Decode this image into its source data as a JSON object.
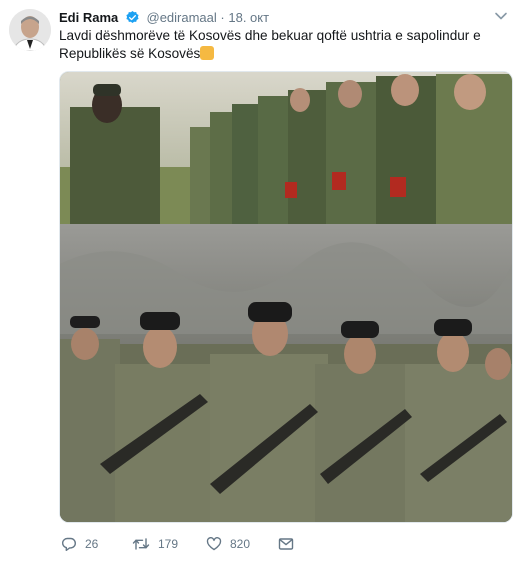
{
  "tweet": {
    "author_name": "Edi Rama",
    "handle": "@ediramaal",
    "separator": "·",
    "date": "18. окт",
    "text": "Lavdi dëshmorëve të Kosovës dhe bekuar qoftë ushtria e sapolindur e Republikës së Kosovës",
    "text_emoji": "folded-hands-emoji",
    "actions": {
      "reply_count": "26",
      "retweet_count": "179",
      "like_count": "820"
    },
    "icons": {
      "verified": "verified-badge-icon",
      "caret": "chevron-down-icon",
      "reply": "reply-icon",
      "retweet": "retweet-icon",
      "like": "heart-icon",
      "dm": "mail-icon"
    }
  },
  "colors": {
    "verified_badge": "#1da1f2",
    "secondary_text": "#657786",
    "primary_text": "#14171a"
  }
}
